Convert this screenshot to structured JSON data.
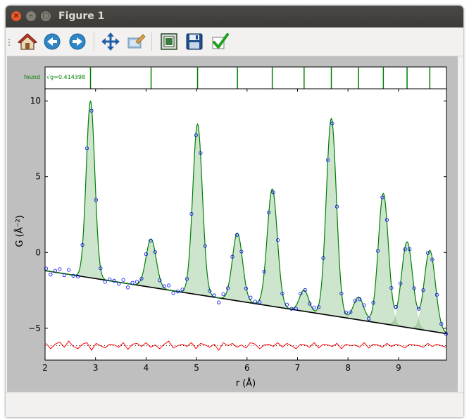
{
  "window": {
    "title": "Figure 1",
    "controls": {
      "close": "×",
      "minimize": "–",
      "maximize": "□"
    }
  },
  "toolbar": {
    "buttons": [
      {
        "name": "home",
        "icon": "home-icon"
      },
      {
        "name": "back",
        "icon": "back-arrow-icon"
      },
      {
        "name": "forward",
        "icon": "forward-arrow-icon"
      },
      {
        "name": "pan",
        "icon": "pan-arrows-icon"
      },
      {
        "name": "zoom",
        "icon": "zoom-rectangle-icon"
      },
      {
        "name": "subplots",
        "icon": "subplots-icon"
      },
      {
        "name": "save",
        "icon": "floppy-disk-icon"
      },
      {
        "name": "ok",
        "icon": "green-checkmark-icon"
      }
    ]
  },
  "chart_data": {
    "type": "line",
    "xlabel": "r (Å)",
    "ylabel": "G (Å⁻²)",
    "xlim": [
      2,
      9.95
    ],
    "ylim": [
      -7.1,
      10.8
    ],
    "xticks": [
      2,
      3,
      4,
      5,
      6,
      7,
      8,
      9
    ],
    "yticks": [
      10,
      5,
      0,
      -5
    ],
    "peak_strip": {
      "label": "found",
      "annotation": "√g=0.414398",
      "line_positions": [
        2.9,
        4.1,
        5.02,
        5.81,
        6.5,
        7.13,
        7.67,
        8.21,
        8.7,
        9.17,
        9.62
      ]
    },
    "baseline": {
      "slope": -0.5227,
      "intercept": -0.154
    },
    "peaks": [
      {
        "center": 2.9,
        "height": 11.65,
        "width": 0.085
      },
      {
        "center": 4.1,
        "height": 3.19,
        "width": 0.1
      },
      {
        "center": 5.02,
        "height": 11.25,
        "width": 0.095
      },
      {
        "center": 5.81,
        "height": 4.47,
        "width": 0.1
      },
      {
        "center": 6.5,
        "height": 7.74,
        "width": 0.1
      },
      {
        "center": 7.13,
        "height": 1.4,
        "width": 0.09
      },
      {
        "center": 7.67,
        "height": 13.0,
        "width": 0.1
      },
      {
        "center": 8.21,
        "height": 1.5,
        "width": 0.1
      },
      {
        "center": 8.7,
        "height": 8.6,
        "width": 0.1
      },
      {
        "center": 9.17,
        "height": 5.65,
        "width": 0.11
      },
      {
        "center": 9.62,
        "height": 5.32,
        "width": 0.11
      }
    ],
    "residual_offset": -6.15,
    "data_x_start": 2.02,
    "data_x_step": 0.09,
    "data_y_noise": [
      0.15,
      -0.2,
      0.1,
      0.25,
      -0.1,
      0.3,
      -0.05,
      -0.2,
      0.1,
      0.2,
      -0.3,
      0.15,
      0.0,
      -0.15,
      0.1,
      0.05,
      -0.1,
      0.2,
      -0.25,
      0.1,
      0.15,
      -0.05,
      0.2,
      -0.1,
      0.05,
      -0.2,
      0.1,
      0.3,
      -0.15,
      0.0,
      0.1,
      -0.05,
      0.2,
      -0.2,
      0.15,
      0.05,
      -0.1,
      0.1,
      -0.3,
      0.2,
      0.0,
      0.15,
      -0.1,
      0.05,
      -0.15,
      0.2,
      0.1,
      -0.2,
      0.05,
      0.1,
      -0.05,
      0.2,
      -0.1,
      0.15,
      0.0,
      -0.2,
      0.1,
      0.05,
      -0.1,
      0.2,
      -0.15,
      0.1,
      0.05,
      -0.05,
      0.15,
      -0.2,
      0.1,
      0.0,
      0.05,
      -0.1,
      0.2,
      -0.15,
      0.1,
      0.05,
      -0.1,
      0.15,
      -0.05,
      0.1,
      0.0,
      -0.15,
      0.1,
      0.05,
      0.0,
      -0.1,
      0.15,
      -0.05,
      0.1,
      0.0,
      -0.1
    ],
    "colors": {
      "fit": "#008000",
      "peak_fill": "#4c9f4c",
      "data": "#0000ff",
      "baseline": "#000000",
      "residual": "#ff0000",
      "residual_zero": "#000000",
      "peak_lines": "#008000"
    }
  }
}
